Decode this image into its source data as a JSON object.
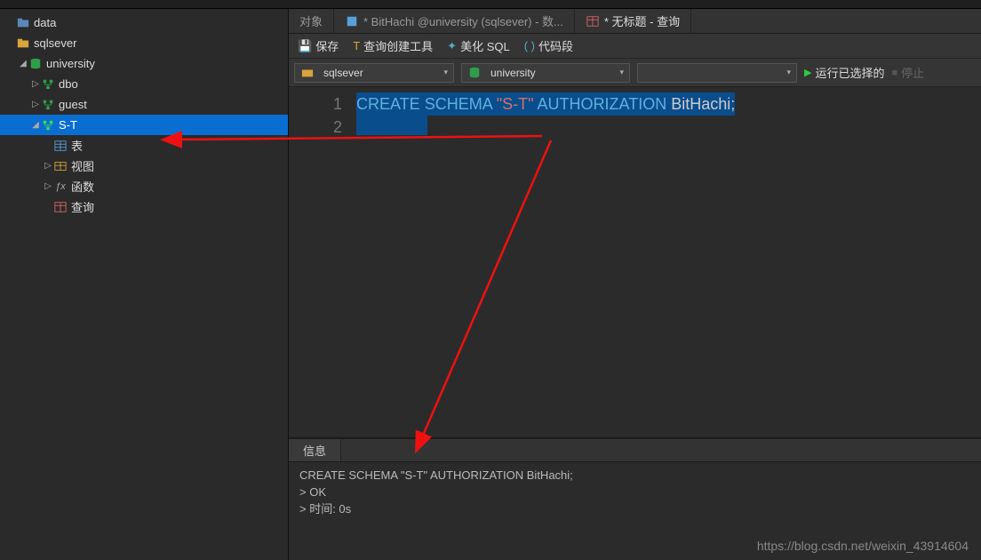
{
  "sidebar": {
    "items": [
      {
        "label": "data",
        "icon": "folder"
      },
      {
        "label": "sqlsever",
        "icon": "folder-orange"
      },
      {
        "label": "university",
        "icon": "database",
        "expanded": true
      },
      {
        "label": "dbo",
        "icon": "schema"
      },
      {
        "label": "guest",
        "icon": "schema"
      },
      {
        "label": "S-T",
        "icon": "schema",
        "selected": true,
        "expanded": true
      },
      {
        "label": "表",
        "icon": "table"
      },
      {
        "label": "视图",
        "icon": "view"
      },
      {
        "label": "函数",
        "icon": "fx"
      },
      {
        "label": "查询",
        "icon": "query"
      }
    ]
  },
  "tabs": [
    {
      "label": "对象"
    },
    {
      "label": "* BitHachi @university (sqlsever) - 数...",
      "icon": "sql"
    },
    {
      "label": "* 无标题 - 查询",
      "icon": "query"
    }
  ],
  "toolbar": {
    "save": "保存",
    "query_builder": "查询创建工具",
    "beautify": "美化 SQL",
    "snippet": "代码段"
  },
  "dropdowns": {
    "conn": "sqlsever",
    "db": "university",
    "extra": ""
  },
  "actions": {
    "run": "运行已选择的",
    "stop": "停止"
  },
  "code": {
    "l1_kw1": "CREATE",
    "l1_sp1": " ",
    "l1_kw2": "SCHEMA",
    "l1_sp2": " ",
    "l1_str": "\"S-T\"",
    "l1_sp3": " ",
    "l1_kw3": "AUTHORIZATION",
    "l1_sp4": " ",
    "l1_id": "BitHachi",
    "l1_semi": ";",
    "ln1": "1",
    "ln2": "2"
  },
  "out": {
    "tab": "信息",
    "l1": "CREATE SCHEMA \"S-T\" AUTHORIZATION BitHachi;",
    "l2": "> OK",
    "l3": "> 时间: 0s"
  },
  "watermark": "https://blog.csdn.net/weixin_43914604"
}
